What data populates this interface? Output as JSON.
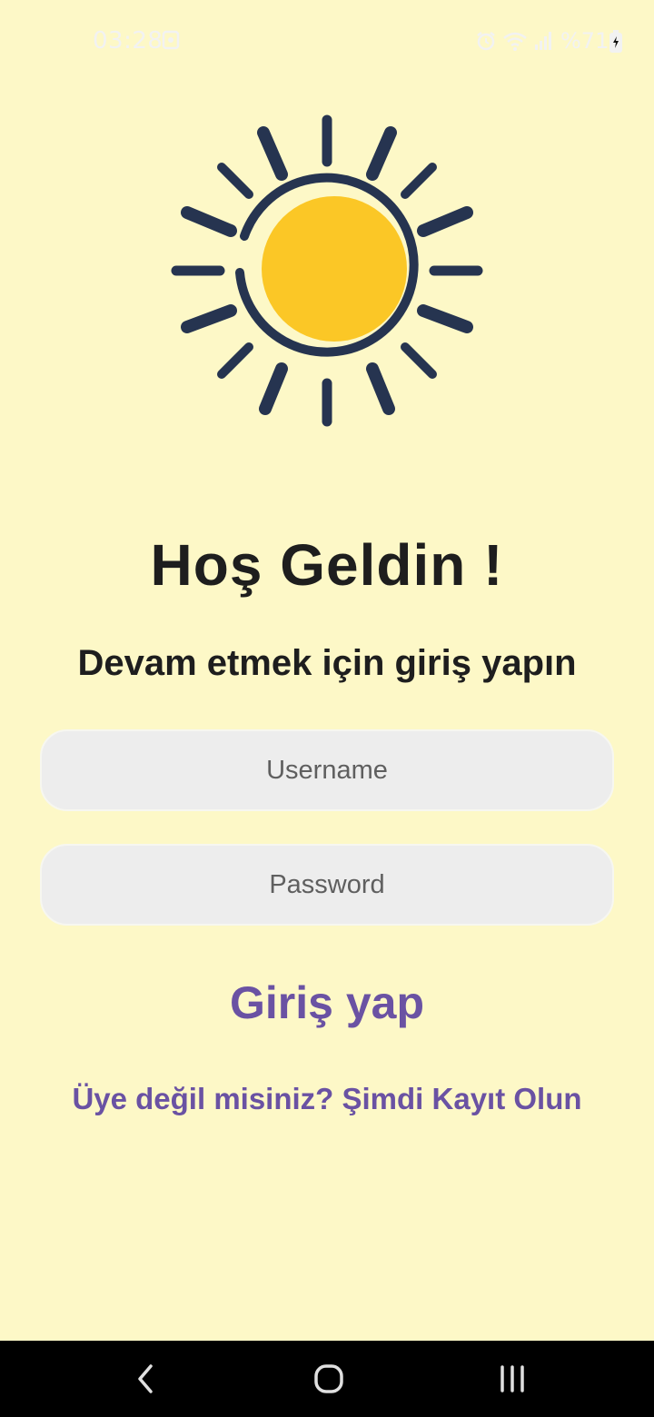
{
  "status_bar": {
    "time": "03:28",
    "battery_text": "%71",
    "icons": [
      "gallery-icon",
      "alarm-icon",
      "wifi-icon",
      "signal-icon",
      "battery-icon"
    ]
  },
  "logo": {
    "icon": "sun-icon",
    "colors": {
      "rays": "#263450",
      "core": "#fbc726"
    }
  },
  "welcome": {
    "title": "Hoş Geldin !",
    "subtitle": "Devam etmek için giriş yapın"
  },
  "form": {
    "username_placeholder": "Username",
    "password_placeholder": "Password",
    "login_label": "Giriş yap",
    "register_label": "Üye değil misiniz? Şimdi Kayıt Olun"
  },
  "nav": {
    "icons": [
      "back-icon",
      "home-icon",
      "recents-icon"
    ]
  },
  "colors": {
    "background": "#fdf8c7",
    "accent": "#6a52a3",
    "field": "#ededed",
    "text": "#1e1e1e"
  }
}
